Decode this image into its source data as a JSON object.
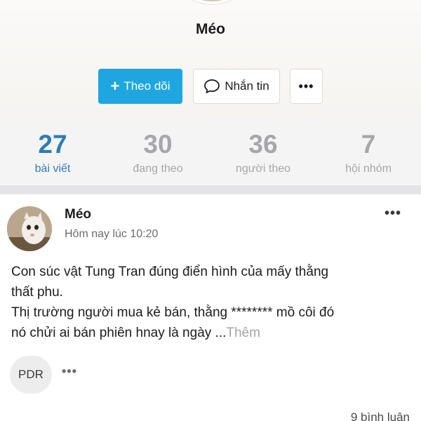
{
  "profile": {
    "name": "Méo"
  },
  "actions": {
    "follow_label": "Theo dõi",
    "message_label": "Nhắn tin",
    "more_label": "•••"
  },
  "stats": [
    {
      "value": "27",
      "label": "bài viết",
      "active": true
    },
    {
      "value": "30",
      "label": "đang theo",
      "active": false
    },
    {
      "value": "36",
      "label": "người theo",
      "active": false
    },
    {
      "value": "7",
      "label": "hội nhóm",
      "active": false
    }
  ],
  "post": {
    "author": "Méo",
    "time": "Hôm nay lúc 10:20",
    "more_label": "•••",
    "body_lines": [
      "Con súc vật Tung Tran đúng điển hình của mấy thằng",
      "thất phu.",
      "Thị trường người mua kẻ bán, thằng ******** mồ côi đó",
      "nó chửi ai bán phiên hnay là ngày ..."
    ],
    "see_more": "Thêm",
    "tag": "PDR",
    "tag_more": "•••",
    "comments": "9 bình luận"
  },
  "colors": {
    "accent": "#1fa6e0",
    "active_stat": "#2e7db6",
    "muted": "#a7a7ab"
  }
}
